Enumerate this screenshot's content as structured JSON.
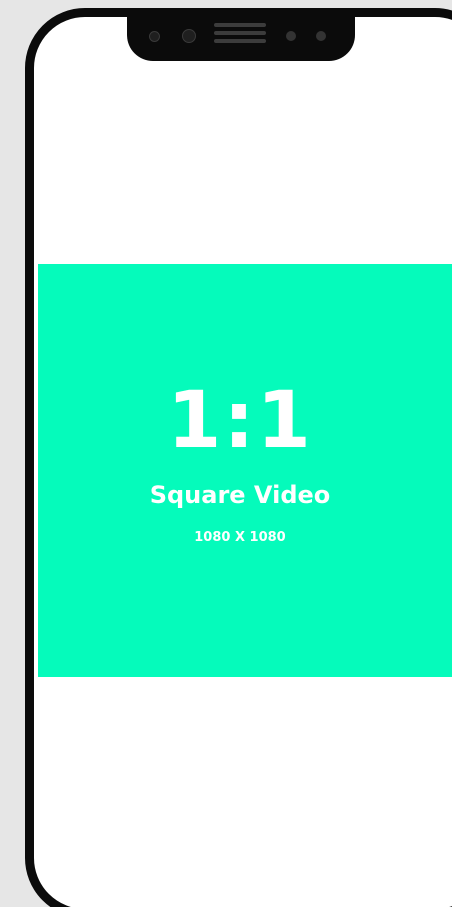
{
  "colors": {
    "background": "#e6e6e6",
    "phone_frame": "#0b0b0b",
    "screen": "#ffffff",
    "video_area": "#05fbbb",
    "text": "#ffffff"
  },
  "icons": {
    "notch": "phone-notch",
    "camera": "camera-icon",
    "speaker": "speaker-grille-icon"
  },
  "video": {
    "ratio_label": "1:1",
    "title": "Square Video",
    "dimensions": "1080 X 1080"
  }
}
